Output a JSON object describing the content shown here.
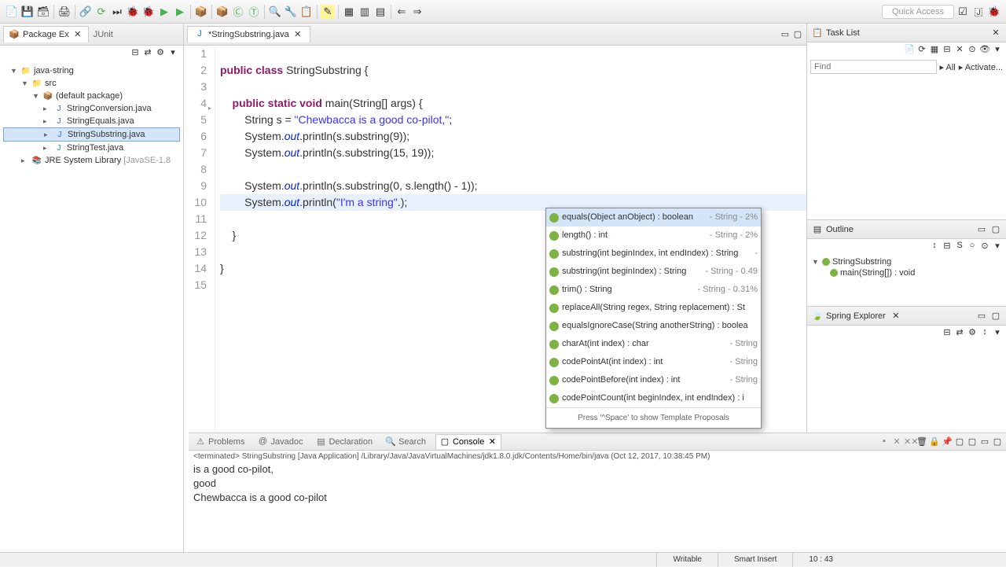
{
  "quick_access": "Quick Access",
  "package_explorer": {
    "title": "Package Ex",
    "junit_tab": "JUnit",
    "project": "java-string",
    "src": "src",
    "pkg": "(default package)",
    "files": [
      "StringConversion.java",
      "StringEquals.java",
      "StringSubstring.java",
      "StringTest.java"
    ],
    "jre": "JRE System Library",
    "jre_ver": "[JavaSE-1.8"
  },
  "editor": {
    "tab": "*StringSubstring.java",
    "lines": {
      "l1": "",
      "l2a": "public",
      "l2b": " class",
      "l2c": " StringSubstring {",
      "l3": "",
      "l4a": "    public",
      "l4b": " static",
      "l4c": " void",
      "l4d": " main(String[] args) {",
      "l5a": "        String s = ",
      "l5b": "\"Chewbacca is a good co-pilot,\"",
      "l5c": ";",
      "l6a": "        System.",
      "l6b": "out",
      "l6c": ".println(s.substring(9));",
      "l7a": "        System.",
      "l7b": "out",
      "l7c": ".println(s.substring(15, 19));",
      "l8": "",
      "l9a": "        System.",
      "l9b": "out",
      "l9c": ".println(s.substring(0, s.length() - 1));",
      "l10a": "        System.",
      "l10b": "out",
      "l10c": ".println(",
      "l10d": "\"I'm a string\"",
      "l10e": ".);",
      "l11": "",
      "l12": "    }",
      "l13": "",
      "l14": "}",
      "l15": ""
    }
  },
  "autocomplete": {
    "items": [
      {
        "sig": "equals(Object anObject) : boolean",
        "meta": "- String - 2%"
      },
      {
        "sig": "length() : int",
        "meta": "- String - 2%"
      },
      {
        "sig": "substring(int beginIndex, int endIndex) : String",
        "meta": "-"
      },
      {
        "sig": "substring(int beginIndex) : String",
        "meta": "- String - 0.49"
      },
      {
        "sig": "trim() : String",
        "meta": "- String - 0.31%"
      },
      {
        "sig": "replaceAll(String regex, String replacement) : St",
        "meta": ""
      },
      {
        "sig": "equalsIgnoreCase(String anotherString) : boolea",
        "meta": ""
      },
      {
        "sig": "charAt(int index) : char",
        "meta": "- String"
      },
      {
        "sig": "codePointAt(int index) : int",
        "meta": "- String"
      },
      {
        "sig": "codePointBefore(int index) : int",
        "meta": "- String"
      },
      {
        "sig": "codePointCount(int beginIndex, int endIndex) : i",
        "meta": ""
      }
    ],
    "footer": "Press '^Space' to show Template Proposals"
  },
  "task_list": {
    "title": "Task List",
    "find": "Find",
    "all": "All",
    "activate": "Activate..."
  },
  "outline": {
    "title": "Outline",
    "class": "StringSubstring",
    "method": "main(String[]) : void"
  },
  "spring": {
    "title": "Spring Explorer"
  },
  "bottom": {
    "tabs": [
      "Problems",
      "Javadoc",
      "Declaration",
      "Search",
      "Console"
    ],
    "sub": "<terminated> StringSubstring [Java Application] /Library/Java/JavaVirtualMachines/jdk1.8.0.jdk/Contents/Home/bin/java (Oct 12, 2017, 10:38:45 PM)",
    "out": [
      " is a good co-pilot,",
      "good",
      "Chewbacca is a good co-pilot"
    ]
  },
  "status": {
    "writable": "Writable",
    "insert": "Smart Insert",
    "pos": "10 : 43"
  }
}
